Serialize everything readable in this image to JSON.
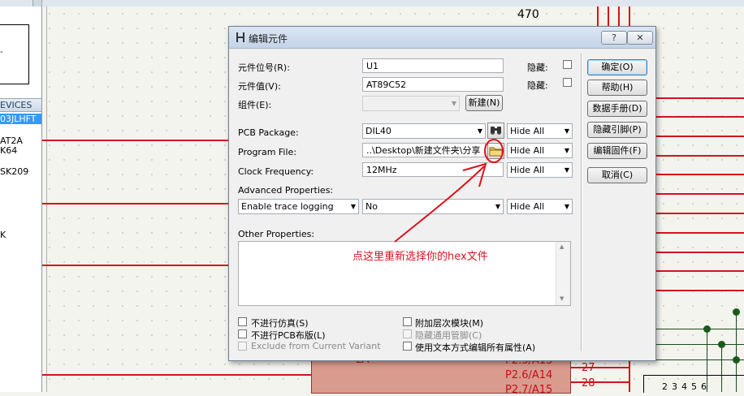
{
  "background": {
    "left_panel": {
      "devices_header": "EVICES",
      "items": [
        "03JLHFT",
        "AT2A",
        "K64",
        "SK209",
        "K"
      ]
    },
    "schematic": {
      "resistor_value": "470",
      "chip_pins": [
        {
          "label": "LA",
          "number": ""
        },
        {
          "label": "P2.5/A13",
          "number": "27"
        },
        {
          "label": "P2.6/A14",
          "number": "28"
        },
        {
          "label": "P2.7/A15",
          "number": ""
        }
      ],
      "connector_pins": [
        "2",
        "3",
        "4",
        "5",
        "6"
      ]
    }
  },
  "dialog": {
    "title": "编辑元件",
    "help_btn": "?",
    "close_btn": "✕",
    "fields": {
      "ref_label": "元件位号(R):",
      "ref_value": "U1",
      "value_label": "元件值(V):",
      "value_value": "AT89C52",
      "group_label": "组件(E):",
      "group_value": "",
      "new_btn": "新建(N)",
      "hidden_label_1": "隐藏:",
      "hidden_label_2": "隐藏:",
      "pcb_label": "PCB Package:",
      "pcb_value": "DIL40",
      "program_label": "Program File:",
      "program_value": "..\\Desktop\\新建文件夹\\分享",
      "clock_label": "Clock Frequency:",
      "clock_value": "12MHz",
      "hide_all_1": "Hide All",
      "hide_all_2": "Hide All",
      "hide_all_3": "Hide All",
      "hide_all_4": "Hide All",
      "advanced_label": "Advanced Properties:",
      "advanced_prop": "Enable trace logging",
      "advanced_value": "No",
      "other_label": "Other Properties:"
    },
    "checkboxes": {
      "no_sim": "不进行仿真(S)",
      "no_pcb": "不进行PCB布版(L)",
      "exclude_variant": "Exclude from Current Variant",
      "attach_hierarchy": "附加层次模块(M)",
      "hide_common_pins": "隐藏通用管脚(C)",
      "edit_text": "使用文本方式编辑所有属性(A)"
    },
    "buttons": {
      "ok": "确定(O)",
      "help": "帮助(H)",
      "datasheet": "数据手册(D)",
      "hidden_pins": "隐藏引脚(P)",
      "edit_firmware": "编辑固件(F)",
      "cancel": "取消(C)"
    },
    "annotation": "点这里重新选择你的hex文件"
  },
  "colors": {
    "wire": "#d8121b",
    "annotation": "#d81420",
    "selection": "#3399ff"
  }
}
